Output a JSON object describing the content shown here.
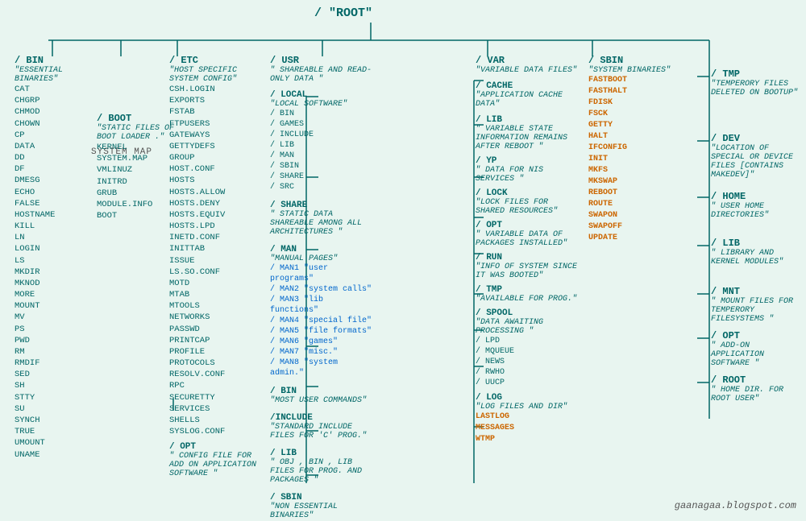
{
  "root": {
    "label": "/   \"ROOT\""
  },
  "watermark": "gaanagaa.blogspot.com",
  "columns": {
    "bin": {
      "title": "/ BIN",
      "desc": "\"ESSENTIAL BINARIES\"",
      "items": [
        "CAT",
        "CHGRP",
        "CHMOD",
        "CHOWN",
        "CP",
        "DATA",
        "DD",
        "DF",
        "DMESG",
        "ECHO",
        "FALSE",
        "HOSTNAME",
        "KILL",
        "LN",
        "LOGIN",
        "LS",
        "MKDIR",
        "MKNOD",
        "MORE",
        "MOUNT",
        "MV",
        "PS",
        "PWD",
        "RM",
        "RMDIF",
        "SED",
        "SH",
        "STTY",
        "SU",
        "SYNCH",
        "TRUE",
        "UMOUNT",
        "UNAME"
      ]
    },
    "boot": {
      "title": "/ BOOT",
      "desc": "\"STATIC FILES OF BOOT LOADER .\"",
      "items": [
        "KERNEL",
        "SYSTEM.MAP",
        "VMLINUZ",
        "INITRD",
        "GRUB",
        "MODULE.INFO",
        "BOOT"
      ]
    },
    "etc": {
      "title": "/ ETC",
      "desc": "\"HOST SPECIFIC SYSTEM CONFIG\"",
      "items": [
        "CSH.LOGIN",
        "EXPORTS",
        "FSTAB",
        "FTPUSERS",
        "GATEWAYS",
        "GETTYDEFS",
        "GROUP",
        "HOST.CONF",
        "HOSTS",
        "HOSTS.ALLOW",
        "HOSTS.DENY",
        "HOSTS.EQUIV",
        "HOSTS.LPD",
        "INETD.CONF",
        "INITTAB",
        "ISSUE",
        "LS.SO.CONF",
        "MOTD",
        "MTAB",
        "MTOOLS",
        "NETWORKS",
        "PASSWD",
        "PRINTCAP",
        "PROFILE",
        "PROTOCOLS",
        "RESOLV.CONF",
        "RPC",
        "SECURETTY",
        "SERVICES",
        "SHELLS",
        "SYSLOG.CONF"
      ],
      "opt": {
        "title": "/ OPT",
        "desc": "\" CONFIG FILE FOR ADD ON APPLICATION SOFTWARE \""
      }
    },
    "usr": {
      "title": "/ USR",
      "desc": "\" SHAREABLE AND READ-ONLY DATA \"",
      "local": {
        "title": "/ LOCAL",
        "desc": "\"LOCAL SOFTWARE\"",
        "items": [
          "/ BIN",
          "/ GAMES",
          "/ INCLUDE",
          "/ LIB",
          "/ MAN",
          "/ SBIN",
          "/ SHARE",
          "/ SRC"
        ]
      },
      "share": {
        "title": "/ SHARE",
        "desc": "\" STATIC DATA SHAREABLE AMONG ALL ARCHITECTURES \""
      },
      "man": {
        "title": "/ MAN",
        "desc": "\"MANUAL PAGES\"",
        "items": [
          "/ MAN1 \"user programs\"",
          "/ MAN2 \"system calls\"",
          "/ MAN3 \"lib functions\"",
          "/ MAN4 \"special file\"",
          "/ MAN5 \"file formats\"",
          "/ MAN6 \"games\"",
          "/ MAN7 \"misc.\"",
          "/ MAN8 \"system admin.\""
        ]
      },
      "bin": {
        "title": "/ BIN",
        "desc": "\"MOST USER COMMANDS\""
      },
      "include": {
        "title": "/ INCLUDE",
        "desc": "\"STANDARD INCLUDE FILES FOR 'C' PROG.\""
      },
      "lib": {
        "title": "/ LIB",
        "desc": "\" OBJ , BIN , LIB FILES FOR PROG. AND PACKAGES \""
      },
      "sbin": {
        "title": "/ SBIN",
        "desc": "\"NON ESSENTIAL BINARIES\""
      }
    },
    "var": {
      "title": "/ VAR",
      "desc": "\"VARIABLE DATA FILES\"",
      "cache": {
        "title": "/ CACHE",
        "desc": "\"APPLICATION CACHE DATA\""
      },
      "lib": {
        "title": "/ LIB",
        "desc": "\" VARIABLE STATE INFORMATION REMAINS AFTER REBOOT \""
      },
      "yp": {
        "title": "/ YP",
        "desc": "\" DATA FOR NIS SERVICES \""
      },
      "lock": {
        "title": "/ LOCK",
        "desc": "\"LOCK FILES FOR SHARED RESOURCES\""
      },
      "opt": {
        "title": "/ OPT",
        "desc": "\" VARIABLE DATA OF PACKAGES INSTALLED\""
      },
      "run": {
        "title": "/ RUN",
        "desc": "\"INFO OF SYSTEM SINCE IT WAS BOOTED\""
      },
      "tmp": {
        "title": "/ TMP",
        "desc": "\"AVAILABLE FOR PROG.\""
      },
      "spool": {
        "title": "/ SPOOL",
        "desc": "\"DATA AWAITING PROCESSING \"",
        "items": [
          "/ LPD",
          "/ MQUEUE",
          "/ NEWS",
          "/ RWHO",
          "/ UUCP"
        ]
      },
      "log": {
        "title": "/ LOG",
        "desc": "\"LOG FILES AND DIR\"",
        "items_highlight": [
          "LASTLOG",
          "MESSAGES",
          "WTMP"
        ]
      }
    },
    "sbin": {
      "title": "/ SBIN",
      "desc": "\"SYSTEM BINARIES\"",
      "items_highlight": [
        "FASTBOOT",
        "FASTHALT",
        "FDISK",
        "FSCK",
        "GETTY",
        "HALT",
        "IFCONFIG",
        "INIT",
        "MKFS",
        "MKSWAP",
        "REBOOT",
        "ROUTE",
        "SWAPON",
        "SWAPOFF",
        "UPDATE"
      ]
    },
    "right": {
      "tmp": {
        "title": "/ TMP",
        "desc": "\"TEMPERORY FILES DELETED ON BOOTUP\""
      },
      "dev": {
        "title": "/ DEV",
        "desc": "\"LOCATION OF SPECIAL OR DEVICE FILES [CONTAINS MAKEDEV]\""
      },
      "home": {
        "title": "/ HOME",
        "desc": "\" USER HOME DIRECTORIES\""
      },
      "lib": {
        "title": "/ LIB",
        "desc": "\"  LIBRARY AND KERNEL MODULES\""
      },
      "mnt": {
        "title": "/ MNT",
        "desc": "\"  MOUNT FILES FOR TEMPERORY FILESYSTEMS \""
      },
      "opt": {
        "title": "/ OPT",
        "desc": "\" ADD-ON APPLICATION SOFTWARE \""
      },
      "root": {
        "title": "/ ROOT",
        "desc": "\" HOME DIR. FOR ROOT USER\""
      }
    }
  }
}
